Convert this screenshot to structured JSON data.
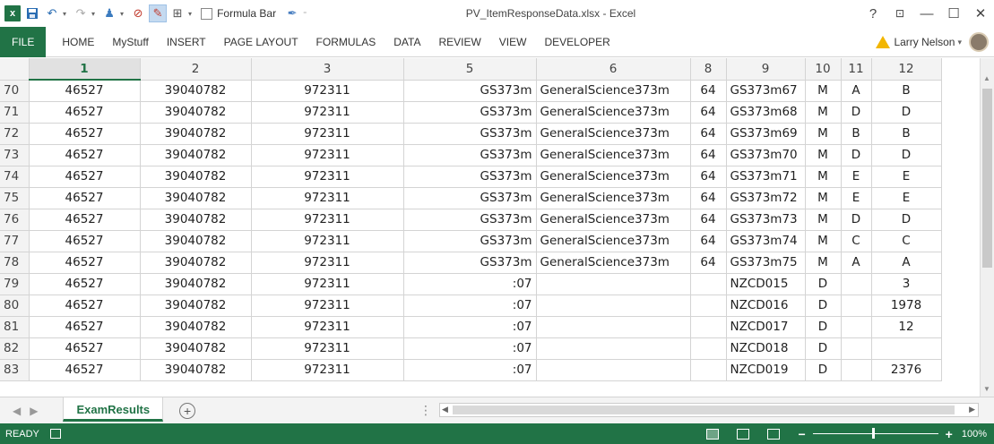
{
  "titlebar": {
    "title": "PV_ItemResponseData.xlsx - Excel",
    "formula_bar_label": "Formula Bar",
    "help": "?",
    "restore": "⊡",
    "minimize": "—",
    "maximize": "☐",
    "close": "✕"
  },
  "ribbon": {
    "tabs": [
      "FILE",
      "HOME",
      "MyStuff",
      "INSERT",
      "PAGE LAYOUT",
      "FORMULAS",
      "DATA",
      "REVIEW",
      "VIEW",
      "DEVELOPER"
    ],
    "user": "Larry Nelson"
  },
  "grid": {
    "columns": [
      "1",
      "2",
      "3",
      "5",
      "6",
      "8",
      "9",
      "10",
      "11",
      "12"
    ],
    "selected_column": "1",
    "rows": [
      {
        "n": "70",
        "cells": [
          "46527",
          "39040782",
          "972311",
          "GS373m",
          "GeneralScience373m",
          "64",
          "GS373m67",
          "M",
          "A",
          "B"
        ]
      },
      {
        "n": "71",
        "cells": [
          "46527",
          "39040782",
          "972311",
          "GS373m",
          "GeneralScience373m",
          "64",
          "GS373m68",
          "M",
          "D",
          "D"
        ]
      },
      {
        "n": "72",
        "cells": [
          "46527",
          "39040782",
          "972311",
          "GS373m",
          "GeneralScience373m",
          "64",
          "GS373m69",
          "M",
          "B",
          "B"
        ]
      },
      {
        "n": "73",
        "cells": [
          "46527",
          "39040782",
          "972311",
          "GS373m",
          "GeneralScience373m",
          "64",
          "GS373m70",
          "M",
          "D",
          "D"
        ]
      },
      {
        "n": "74",
        "cells": [
          "46527",
          "39040782",
          "972311",
          "GS373m",
          "GeneralScience373m",
          "64",
          "GS373m71",
          "M",
          "E",
          "E"
        ]
      },
      {
        "n": "75",
        "cells": [
          "46527",
          "39040782",
          "972311",
          "GS373m",
          "GeneralScience373m",
          "64",
          "GS373m72",
          "M",
          "E",
          "E"
        ]
      },
      {
        "n": "76",
        "cells": [
          "46527",
          "39040782",
          "972311",
          "GS373m",
          "GeneralScience373m",
          "64",
          "GS373m73",
          "M",
          "D",
          "D"
        ]
      },
      {
        "n": "77",
        "cells": [
          "46527",
          "39040782",
          "972311",
          "GS373m",
          "GeneralScience373m",
          "64",
          "GS373m74",
          "M",
          "C",
          "C"
        ]
      },
      {
        "n": "78",
        "cells": [
          "46527",
          "39040782",
          "972311",
          "GS373m",
          "GeneralScience373m",
          "64",
          "GS373m75",
          "M",
          "A",
          "A"
        ]
      },
      {
        "n": "79",
        "cells": [
          "46527",
          "39040782",
          "972311",
          ":07",
          "",
          "",
          "NZCD015",
          "D",
          "",
          "3"
        ]
      },
      {
        "n": "80",
        "cells": [
          "46527",
          "39040782",
          "972311",
          ":07",
          "",
          "",
          "NZCD016",
          "D",
          "",
          "1978"
        ]
      },
      {
        "n": "81",
        "cells": [
          "46527",
          "39040782",
          "972311",
          ":07",
          "",
          "",
          "NZCD017",
          "D",
          "",
          "12"
        ]
      },
      {
        "n": "82",
        "cells": [
          "46527",
          "39040782",
          "972311",
          ":07",
          "",
          "",
          "NZCD018",
          "D",
          "",
          ""
        ]
      },
      {
        "n": "83",
        "cells": [
          "46527",
          "39040782",
          "972311",
          ":07",
          "",
          "",
          "NZCD019",
          "D",
          "",
          "2376"
        ]
      }
    ]
  },
  "sheets": {
    "active": "ExamResults",
    "add_symbol": "+"
  },
  "status": {
    "ready": "READY",
    "zoom": "100%",
    "zoom_minus": "−",
    "zoom_plus": "+"
  },
  "colors": {
    "excel_green": "#217346",
    "header_bg": "#f3f3f3",
    "grid_line": "#d4d4d4"
  }
}
